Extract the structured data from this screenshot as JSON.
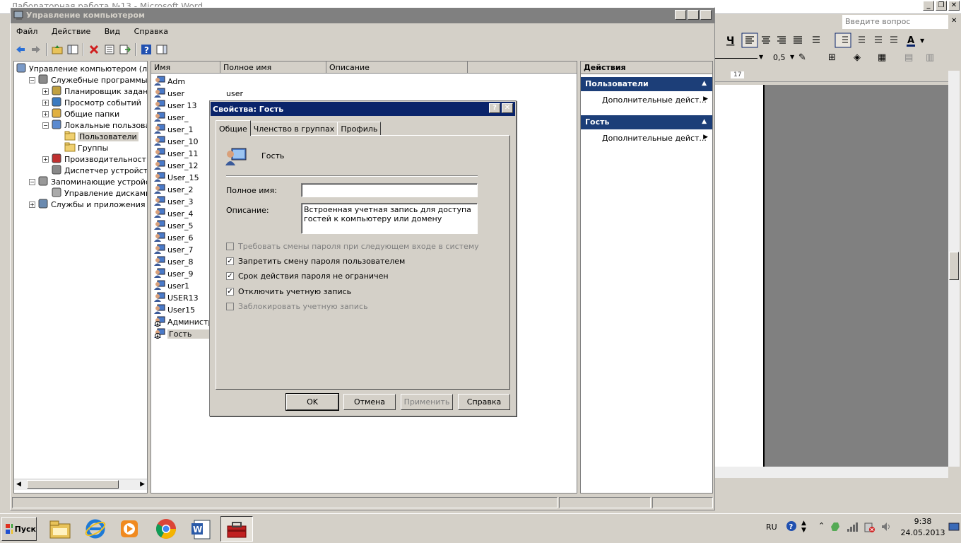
{
  "word": {
    "title": "Лабораторная работа №13 - Microsoft Word",
    "help_placeholder": "Введите вопрос",
    "line_width": "0,5",
    "ruler_mark": "17"
  },
  "mmc": {
    "title": "Управление компьютером",
    "menu": [
      "Файл",
      "Действие",
      "Вид",
      "Справка"
    ],
    "tree": [
      {
        "label": "Управление компьютером (лока",
        "indent": 0,
        "expander": "",
        "icon": "computer-icon"
      },
      {
        "label": "Служебные программы",
        "indent": 1,
        "expander": "−",
        "icon": "tools-icon"
      },
      {
        "label": "Планировщик заданий",
        "indent": 2,
        "expander": "+",
        "icon": "clock-icon"
      },
      {
        "label": "Просмотр событий",
        "indent": 2,
        "expander": "+",
        "icon": "event-viewer-icon"
      },
      {
        "label": "Общие папки",
        "indent": 2,
        "expander": "+",
        "icon": "shared-folder-icon"
      },
      {
        "label": "Локальные пользователи",
        "indent": 2,
        "expander": "−",
        "icon": "users-icon"
      },
      {
        "label": "Пользователи",
        "indent": 3,
        "expander": "",
        "icon": "folder-icon",
        "selected": true
      },
      {
        "label": "Группы",
        "indent": 3,
        "expander": "",
        "icon": "folder-icon"
      },
      {
        "label": "Производительность",
        "indent": 2,
        "expander": "+",
        "icon": "performance-icon"
      },
      {
        "label": "Диспетчер устройств",
        "indent": 2,
        "expander": "",
        "icon": "device-manager-icon"
      },
      {
        "label": "Запоминающие устройства",
        "indent": 1,
        "expander": "−",
        "icon": "storage-icon"
      },
      {
        "label": "Управление дисками",
        "indent": 2,
        "expander": "",
        "icon": "disk-icon"
      },
      {
        "label": "Службы и приложения",
        "indent": 1,
        "expander": "+",
        "icon": "services-icon"
      }
    ],
    "columns": [
      "Имя",
      "Полное имя",
      "Описание"
    ],
    "users": [
      {
        "name": "Adm",
        "full": ""
      },
      {
        "name": "user",
        "full": "user"
      },
      {
        "name": "user 13",
        "full": ""
      },
      {
        "name": "user_",
        "full": ""
      },
      {
        "name": "user_1",
        "full": ""
      },
      {
        "name": "user_10",
        "full": ""
      },
      {
        "name": "user_11",
        "full": ""
      },
      {
        "name": "user_12",
        "full": ""
      },
      {
        "name": "User_15",
        "full": ""
      },
      {
        "name": "user_2",
        "full": ""
      },
      {
        "name": "user_3",
        "full": ""
      },
      {
        "name": "user_4",
        "full": ""
      },
      {
        "name": "user_5",
        "full": ""
      },
      {
        "name": "user_6",
        "full": ""
      },
      {
        "name": "user_7",
        "full": ""
      },
      {
        "name": "user_8",
        "full": ""
      },
      {
        "name": "user_9",
        "full": ""
      },
      {
        "name": "user1",
        "full": ""
      },
      {
        "name": "USER13",
        "full": ""
      },
      {
        "name": "User15",
        "full": ""
      },
      {
        "name": "Администра",
        "full": "",
        "disabled": true
      },
      {
        "name": "Гость",
        "full": "",
        "disabled": true,
        "selected": true
      }
    ],
    "actions": {
      "header": "Действия",
      "sections": [
        {
          "title": "Пользователи",
          "item": "Дополнительные дейст..."
        },
        {
          "title": "Гость",
          "item": "Дополнительные дейст..."
        }
      ]
    }
  },
  "dialog": {
    "title": "Свойства: Гость",
    "tabs": [
      "Общие",
      "Членство в группах",
      "Профиль"
    ],
    "username": "Гость",
    "full_name_label": "Полное имя:",
    "full_name_value": "",
    "description_label": "Описание:",
    "description_value": "Встроенная учетная запись для доступа гостей к компьютеру или домену",
    "checkboxes": [
      {
        "label": "Требовать смены пароля при следующем входе в систему",
        "checked": false,
        "disabled": true
      },
      {
        "label": "Запретить смену пароля пользователем",
        "checked": true,
        "disabled": false
      },
      {
        "label": "Срок действия пароля не ограничен",
        "checked": true,
        "disabled": false
      },
      {
        "label": "Отключить учетную запись",
        "checked": true,
        "disabled": false
      },
      {
        "label": "Заблокировать учетную запись",
        "checked": false,
        "disabled": true
      }
    ],
    "buttons": {
      "ok": "OK",
      "cancel": "Отмена",
      "apply": "Применить",
      "help": "Справка"
    }
  },
  "taskbar": {
    "start": "Пуск",
    "lang": "RU",
    "time": "9:38",
    "date": "24.05.2013"
  },
  "colors": {
    "dialog_title": "#0a246a",
    "action_section": "#1c3e78",
    "inactive_title": "#808080"
  }
}
